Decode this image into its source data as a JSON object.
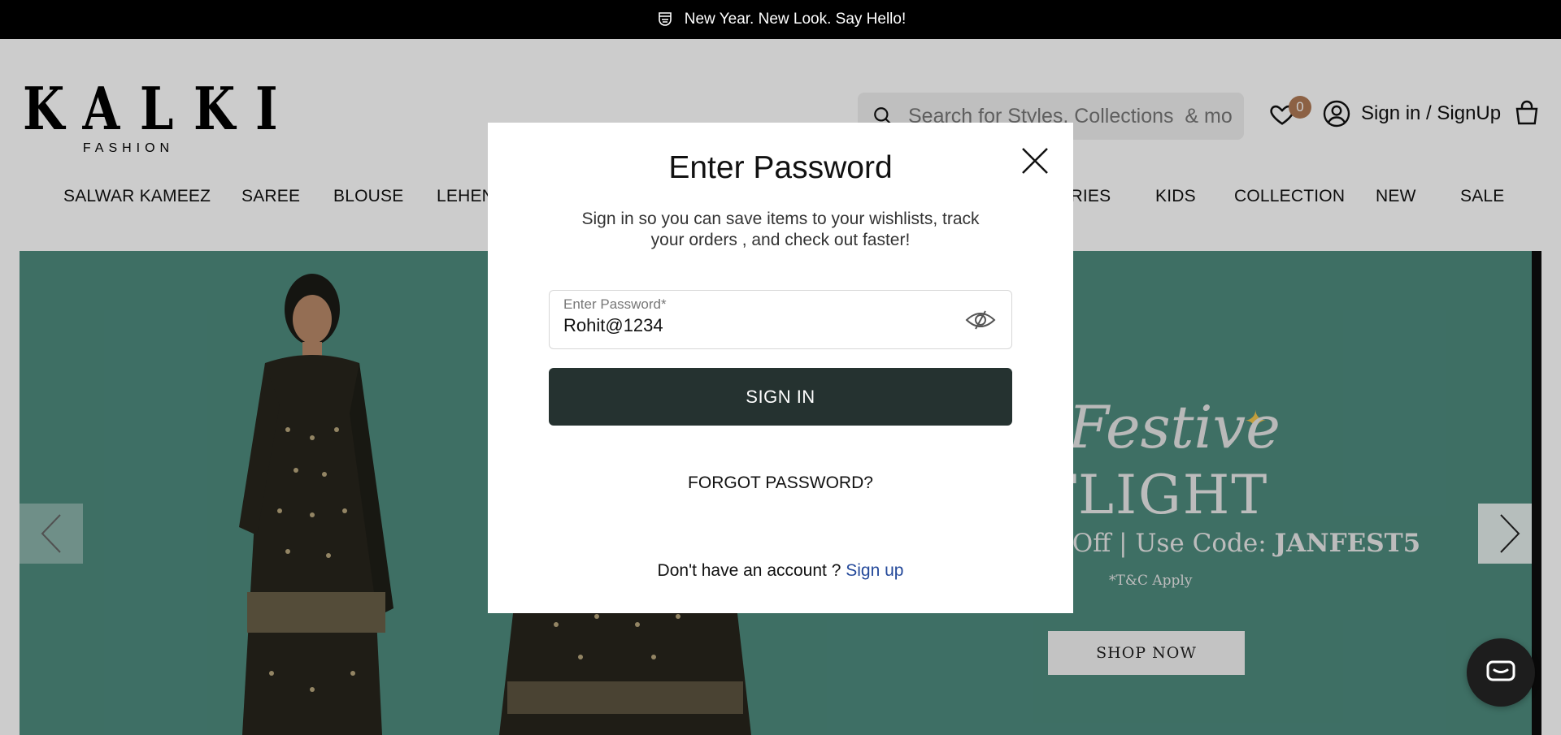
{
  "announcement": {
    "text": "New Year. New Look. Say Hello!",
    "icon": "face-mask-icon"
  },
  "header": {
    "logo_main": "KALKI",
    "logo_sub": "FASHION",
    "search_placeholder": "Search for Styles, Collections  & more",
    "wishlist_count": "0",
    "signin_label": "Sign in / SignUp"
  },
  "nav": {
    "items": [
      "SALWAR KAMEEZ",
      "SAREE",
      "BLOUSE",
      "LEHENGA",
      "ACCESSORIES",
      "KIDS",
      "COLLECTION",
      "NEW",
      "SALE"
    ],
    "visible": {
      "salwar": "SALWAR KAMEEZ",
      "saree": "SAREE",
      "blouse": "BLOUSE",
      "lehenga_partial": "LEHENG",
      "accessories_partial": "ORIES",
      "kids": "KIDS",
      "collection": "COLLECTION",
      "new": "NEW",
      "sale": "SALE"
    }
  },
  "hero": {
    "festive": "Festive",
    "spotlight": "OTLIGHT",
    "offer_prefix": "% *Off | Use Code: ",
    "offer_code": "JANFEST5",
    "tnc": "*T&C Apply",
    "cta": "SHOP NOW",
    "colors": {
      "background": "#4e8b7e"
    }
  },
  "modal": {
    "title": "Enter Password",
    "description": "Sign in so you can save items to your wishlists, track your orders , and check out faster!",
    "password_label": "Enter Password*",
    "password_value": "Rohit@1234",
    "signin_button": "SIGN IN",
    "forgot_password": "FORGOT PASSWORD?",
    "no_account_text": "Don't have an account ? ",
    "signup_link": "Sign up"
  },
  "colors": {
    "primary_button": "#253230",
    "badge": "#b07a55",
    "link": "#24499a"
  }
}
